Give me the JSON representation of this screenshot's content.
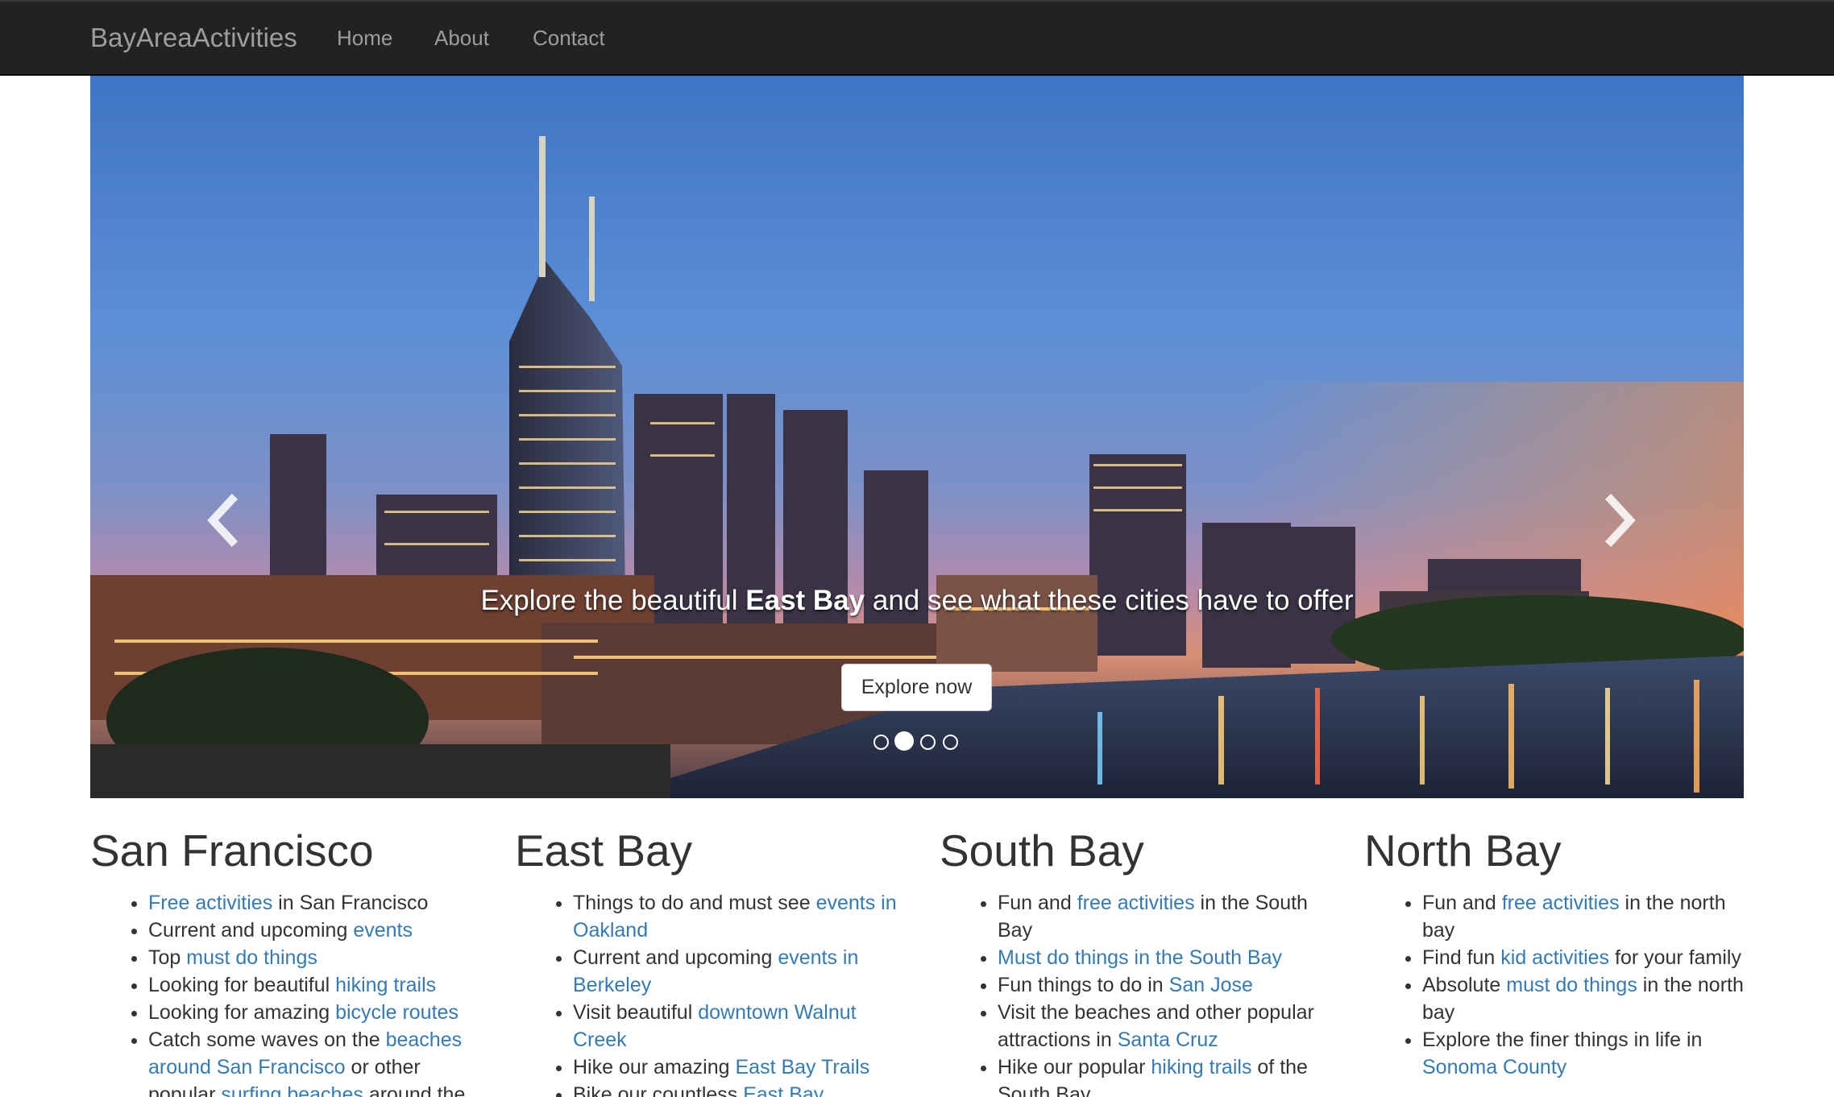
{
  "navbar": {
    "brand": "BayAreaActivities",
    "links": [
      "Home",
      "About",
      "Contact"
    ]
  },
  "carousel": {
    "caption_pre": "Explore the beautiful ",
    "caption_bold": "East Bay",
    "caption_post": " and see what these cities have to offer",
    "button_label": "Explore now",
    "slide_count": 4,
    "active_slide": 2,
    "prev_icon": "chevron-left-icon",
    "next_icon": "chevron-right-icon"
  },
  "colors": {
    "navbar_bg": "#222222",
    "nav_text": "#9d9d9d",
    "link": "#337ab7",
    "text": "#333333"
  },
  "columns": [
    {
      "title": "San Francisco",
      "items": [
        {
          "link": "Free activities",
          "post": " in San Francisco"
        },
        {
          "pre": "Current and upcoming ",
          "link": "events"
        },
        {
          "pre": "Top ",
          "link": "must do things"
        },
        {
          "pre": "Looking for beautiful ",
          "link": "hiking trails"
        },
        {
          "pre": "Looking for amazing ",
          "link": "bicycle routes"
        },
        {
          "pre": "Catch some waves on the ",
          "link": "beaches around San Francisco",
          "post": " or other popular ",
          "link2": "surfing beaches",
          "post2": " around the"
        }
      ]
    },
    {
      "title": "East Bay",
      "items": [
        {
          "pre": "Things to do and must see ",
          "link": "events in Oakland"
        },
        {
          "pre": "Current and upcoming ",
          "link": "events in Berkeley"
        },
        {
          "pre": "Visit beautiful ",
          "link": "downtown Walnut Creek"
        },
        {
          "pre": "Hike our amazing ",
          "link": "East Bay Trails"
        },
        {
          "pre": "Bike our countless ",
          "link": "East Bay"
        }
      ]
    },
    {
      "title": "South Bay",
      "items": [
        {
          "pre": "Fun and ",
          "link": "free activities",
          "post": " in the South Bay"
        },
        {
          "link": "Must do things in the South Bay"
        },
        {
          "pre": "Fun things to do in ",
          "link": "San Jose"
        },
        {
          "pre": "Visit the beaches and other popular attractions in ",
          "link": "Santa Cruz"
        },
        {
          "pre": "Hike our popular ",
          "link": "hiking trails",
          "post": " of the South Bay"
        }
      ]
    },
    {
      "title": "North Bay",
      "items": [
        {
          "pre": "Fun and ",
          "link": "free activities",
          "post": " in the north bay"
        },
        {
          "pre": "Find fun ",
          "link": "kid activities",
          "post": " for your family"
        },
        {
          "pre": "Absolute ",
          "link": "must do things",
          "post": " in the north bay"
        },
        {
          "pre": "Explore the finer things in life in ",
          "link": "Sonoma County"
        }
      ]
    }
  ]
}
